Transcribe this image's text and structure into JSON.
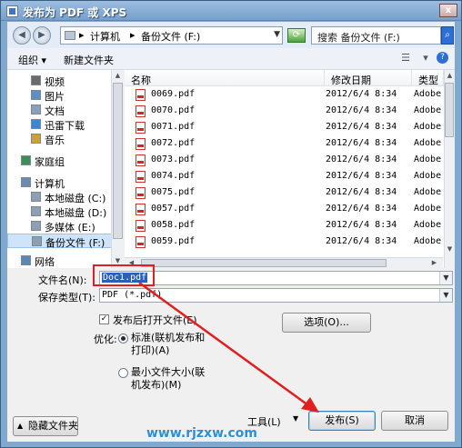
{
  "window": {
    "title": "发布为 PDF 或 XPS",
    "close_glyph": "x"
  },
  "address": {
    "crumbs": [
      "计算机",
      "备份文件 (F:)"
    ],
    "separator": "▸",
    "search_placeholder": "搜索 备份文件 (F:)"
  },
  "toolbar": {
    "organize": "组织 ▾",
    "new_folder": "新建文件夹"
  },
  "nav": {
    "items": [
      {
        "label": "视频",
        "color": "#6a6a6a"
      },
      {
        "label": "图片",
        "color": "#5f8fbf"
      },
      {
        "label": "文档",
        "color": "#8ba0b8"
      },
      {
        "label": "迅雷下载",
        "color": "#3a87d2"
      },
      {
        "label": "音乐",
        "color": "#c9a23a"
      },
      {
        "label": "家庭组",
        "color": "#3d8f58"
      },
      {
        "label": "计算机",
        "color": "#6c8bb0"
      },
      {
        "label": "本地磁盘 (C:)",
        "color": "#8f9fb3"
      },
      {
        "label": "本地磁盘 (D:)",
        "color": "#8f9fb3"
      },
      {
        "label": "多媒体 (E:)",
        "color": "#8f9fb3"
      },
      {
        "label": "备份文件 (F:)",
        "color": "#8f9fb3"
      },
      {
        "label": "网络",
        "color": "#5c86b5"
      }
    ]
  },
  "columns": {
    "name": "名称",
    "date": "修改日期",
    "type": "类型"
  },
  "files": [
    {
      "name": "0069.pdf",
      "date": "2012/6/4 8:34",
      "type": "Adobe A"
    },
    {
      "name": "0070.pdf",
      "date": "2012/6/4 8:34",
      "type": "Adobe A"
    },
    {
      "name": "0071.pdf",
      "date": "2012/6/4 8:34",
      "type": "Adobe A"
    },
    {
      "name": "0072.pdf",
      "date": "2012/6/4 8:34",
      "type": "Adobe A"
    },
    {
      "name": "0073.pdf",
      "date": "2012/6/4 8:34",
      "type": "Adobe A"
    },
    {
      "name": "0074.pdf",
      "date": "2012/6/4 8:34",
      "type": "Adobe A"
    },
    {
      "name": "0075.pdf",
      "date": "2012/6/4 8:34",
      "type": "Adobe A"
    },
    {
      "name": "0057.pdf",
      "date": "2012/6/4 8:34",
      "type": "Adobe A"
    },
    {
      "name": "0058.pdf",
      "date": "2012/6/4 8:34",
      "type": "Adobe A"
    },
    {
      "name": "0059.pdf",
      "date": "2012/6/4 8:34",
      "type": "Adobe A"
    }
  ],
  "form": {
    "filename_label": "文件名(N):",
    "filename_value": "Doc1.pdf",
    "savetype_label": "保存类型(T):",
    "savetype_value": "PDF (*.pdf)",
    "open_after_label": "发布后打开文件(E)",
    "open_after_checked": true,
    "optimize_label": "优化:",
    "opt_standard": "标准(联机发布和打印)(A)",
    "opt_minimum": "最小文件大小(联机发布)(M)",
    "options_button": "选项(O)...",
    "tools_button": "工具(L)",
    "publish_button": "发布(S)",
    "cancel_button": "取消",
    "hide_folders": "隐藏文件夹"
  },
  "watermark": "www.rjzxw.com",
  "colors": {
    "accent": "#2a5fba",
    "highlight_box": "#e02020",
    "watermark": "#2d8fd6"
  }
}
